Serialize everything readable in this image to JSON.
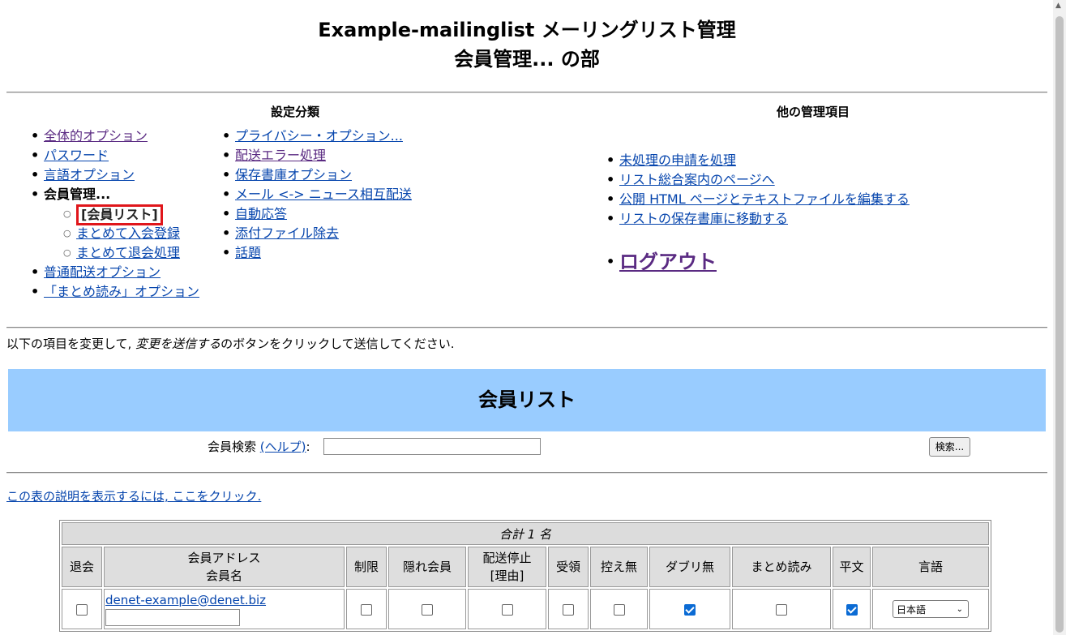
{
  "header": {
    "title_line1": "Example-mailinglist メーリングリスト管理",
    "title_line2": "会員管理... の部"
  },
  "settings": {
    "heading": "設定分類",
    "left_items": [
      {
        "label": "全体的オプション"
      },
      {
        "label": "パスワード"
      },
      {
        "label": "言語オプション"
      },
      {
        "label": "会員管理..."
      },
      {
        "label": "[会員リスト]"
      },
      {
        "label": "まとめて入会登録"
      },
      {
        "label": "まとめて退会処理"
      },
      {
        "label": "普通配送オプション"
      },
      {
        "label": "「まとめ読み」オプション"
      }
    ],
    "right_items": [
      {
        "label": "プライバシー・オプション..."
      },
      {
        "label": "配送エラー処理"
      },
      {
        "label": "保存書庫オプション"
      },
      {
        "label": "メール <-> ニュース相互配送"
      },
      {
        "label": "自動応答"
      },
      {
        "label": "添付ファイル除去"
      },
      {
        "label": "話題"
      }
    ]
  },
  "other": {
    "heading": "他の管理項目",
    "items": [
      {
        "label": "未処理の申請を処理"
      },
      {
        "label": "リスト総合案内のページへ"
      },
      {
        "label": "公開 HTML ページとテキストファイルを編集する"
      },
      {
        "label": "リストの保存書庫に移動する"
      }
    ],
    "logout": "ログアウト"
  },
  "instruction": {
    "prefix": "以下の項目を変更して, ",
    "emph": "変更を送信する",
    "suffix": "のボタンをクリックして送信してください."
  },
  "banner": "会員リスト",
  "search": {
    "label": "会員検索 ",
    "help": "(ヘルプ)",
    "colon": ":",
    "value": "",
    "button": "検索..."
  },
  "legend_link": "この表の説明を表示するには, ここをクリック.",
  "table": {
    "total": "合計 1 名",
    "headers": {
      "unsub": "退会",
      "address": "会員アドレス",
      "name": "会員名",
      "mod": "制限",
      "hide": "隠れ会員",
      "nomail": "配送停止",
      "nomail_reason": "[理由]",
      "ack": "受領",
      "notmetoo": "控え無",
      "nodupes": "ダブリ無",
      "digest": "まとめ読み",
      "plain": "平文",
      "language": "言語"
    },
    "rows": [
      {
        "email": "denet-example@denet.biz",
        "name": "",
        "unsub": false,
        "mod": false,
        "hide": false,
        "nomail": false,
        "ack": false,
        "notmetoo": false,
        "nodupes": true,
        "digest": false,
        "plain": true,
        "language": "日本語"
      }
    ]
  },
  "colors": {
    "link": "#0645ad",
    "visited": "#5a2a82",
    "banner": "#99ccff",
    "highlight_border": "#e0161b",
    "checkbox_checked": "#0b6bd4"
  },
  "icons": {
    "scroll_up": "triangle-up-icon",
    "select_chevron": "chevron-down-icon"
  }
}
